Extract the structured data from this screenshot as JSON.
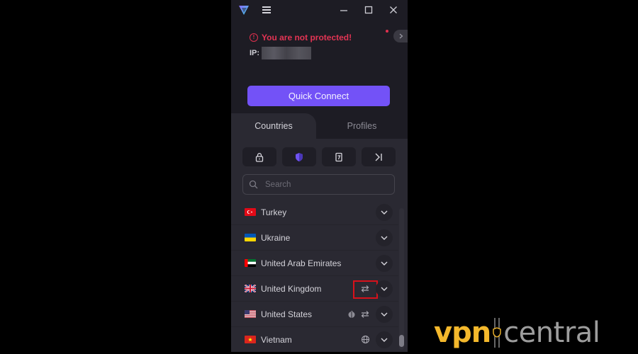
{
  "window": {
    "controls": {
      "minimize": "minimize",
      "maximize": "maximize",
      "close": "close"
    }
  },
  "status": {
    "message": "You are not protected!",
    "ip_label": "IP:",
    "ip_value_blurred": true,
    "color": "#e33454"
  },
  "quick_connect": {
    "label": "Quick Connect",
    "color": "#7352f7"
  },
  "tabs": [
    {
      "label": "Countries",
      "active": true
    },
    {
      "label": "Profiles",
      "active": false
    }
  ],
  "filters": [
    {
      "icon": "lock-icon",
      "active": false
    },
    {
      "icon": "shield-icon",
      "active": true
    },
    {
      "icon": "tor-card-icon",
      "active": false
    },
    {
      "icon": "secure-core-icon",
      "active": false
    }
  ],
  "search": {
    "placeholder": "Search",
    "value": ""
  },
  "countries": [
    {
      "name": "Turkey",
      "flag": "tr",
      "features": []
    },
    {
      "name": "Ukraine",
      "flag": "ua",
      "features": []
    },
    {
      "name": "United Arab Emirates",
      "flag": "ae",
      "features": []
    },
    {
      "name": "United Kingdom",
      "flag": "gb",
      "features": [
        "p2p-icon"
      ],
      "highlighted": true
    },
    {
      "name": "United States",
      "flag": "us",
      "features": [
        "tor-icon",
        "p2p-icon"
      ]
    },
    {
      "name": "Vietnam",
      "flag": "vn",
      "features": [
        "globe-icon"
      ]
    }
  ],
  "watermark": {
    "part1": "vpn",
    "part2": "central"
  }
}
